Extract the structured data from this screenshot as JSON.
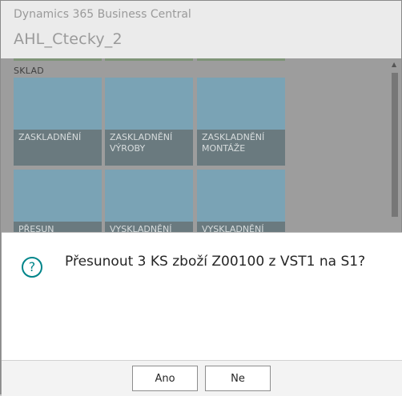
{
  "header": {
    "product": "Dynamics 365 Business Central",
    "company": "AHL_Ctecky_2"
  },
  "section": {
    "label": "SKLAD",
    "tiles": [
      {
        "label": "ZASKLADNĚNÍ"
      },
      {
        "label": "ZASKLADNĚNÍ VÝROBY"
      },
      {
        "label": "ZASKLADNĚNÍ MONTÁŽE"
      },
      {
        "label": "PŘESUN"
      },
      {
        "label": "VYSKLADNĚNÍ"
      },
      {
        "label": "VYSKLADNĚNÍ"
      }
    ]
  },
  "dialog": {
    "icon": "question-icon",
    "message": "Přesunout 3 KS zboží Z00100 z VST1 na S1?",
    "yes_label": "Ano",
    "no_label": "Ne"
  },
  "colors": {
    "accent": "#00858a",
    "tile": "#7aa3b5"
  }
}
